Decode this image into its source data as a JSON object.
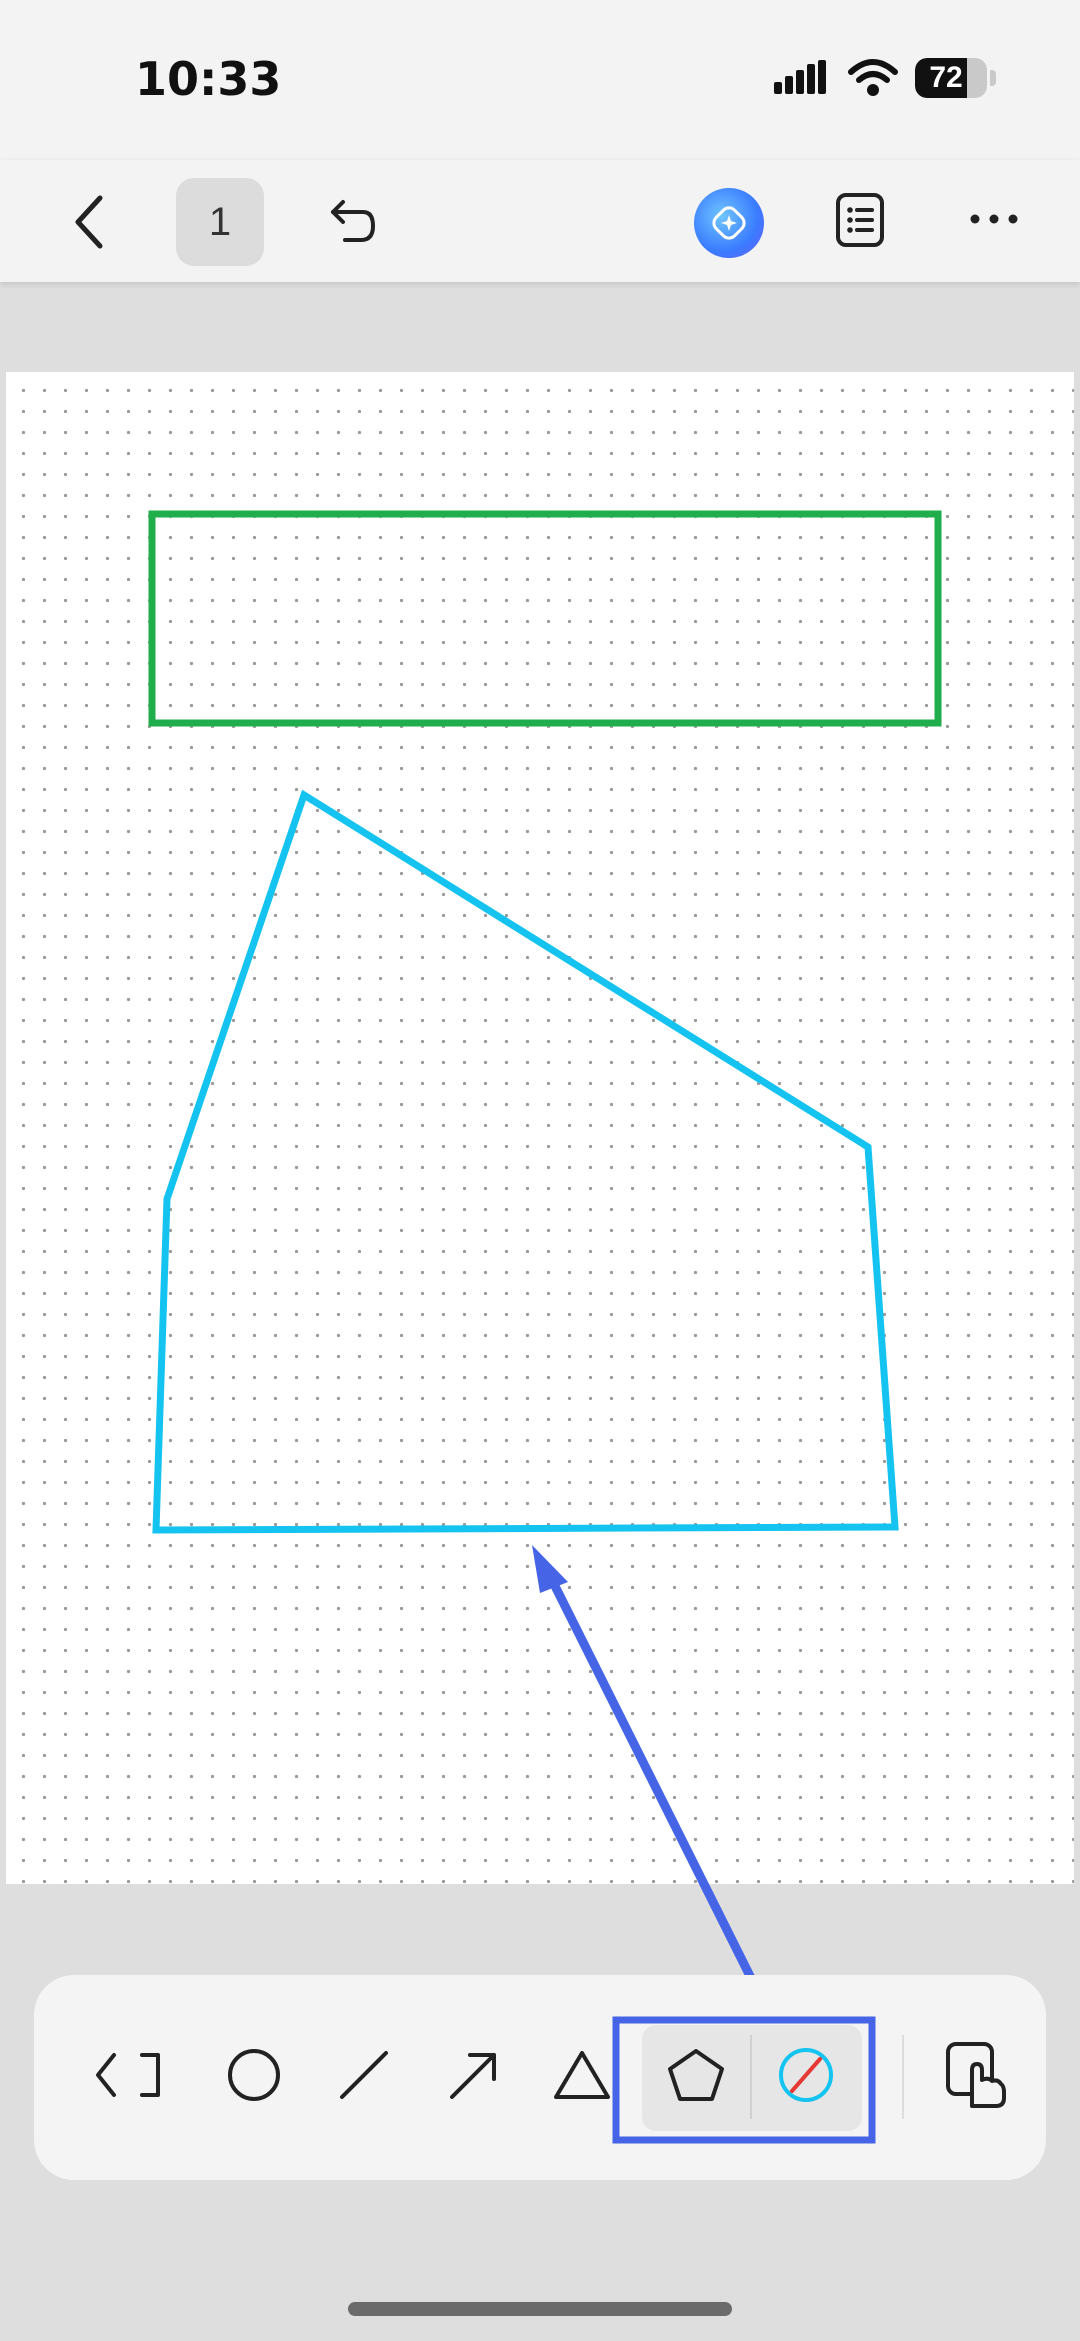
{
  "status_bar": {
    "time": "10:33",
    "battery_level": "72",
    "battery_fraction": 0.72
  },
  "toolbar": {
    "page_number": "1",
    "icons": [
      "back-chevron-icon",
      "undo-icon",
      "ai-assistant-icon",
      "list-icon",
      "more-icon"
    ]
  },
  "canvas": {
    "background": "dot-grid",
    "shapes": [
      {
        "type": "rectangle",
        "color": "#1fae4b"
      },
      {
        "type": "pentagon",
        "color": "#14c3f0"
      },
      {
        "type": "annotation-arrow",
        "color": "#4665e6"
      }
    ]
  },
  "shape_tools": {
    "items": [
      "bracket-icon",
      "circle-icon",
      "line-icon",
      "arrow-icon",
      "triangle-icon",
      "pentagon-icon",
      "no-fill-color-icon",
      "touch-hand-icon"
    ],
    "highlighted": [
      "pentagon-icon",
      "no-fill-color-icon"
    ],
    "highlight_color": "#4665e6"
  }
}
